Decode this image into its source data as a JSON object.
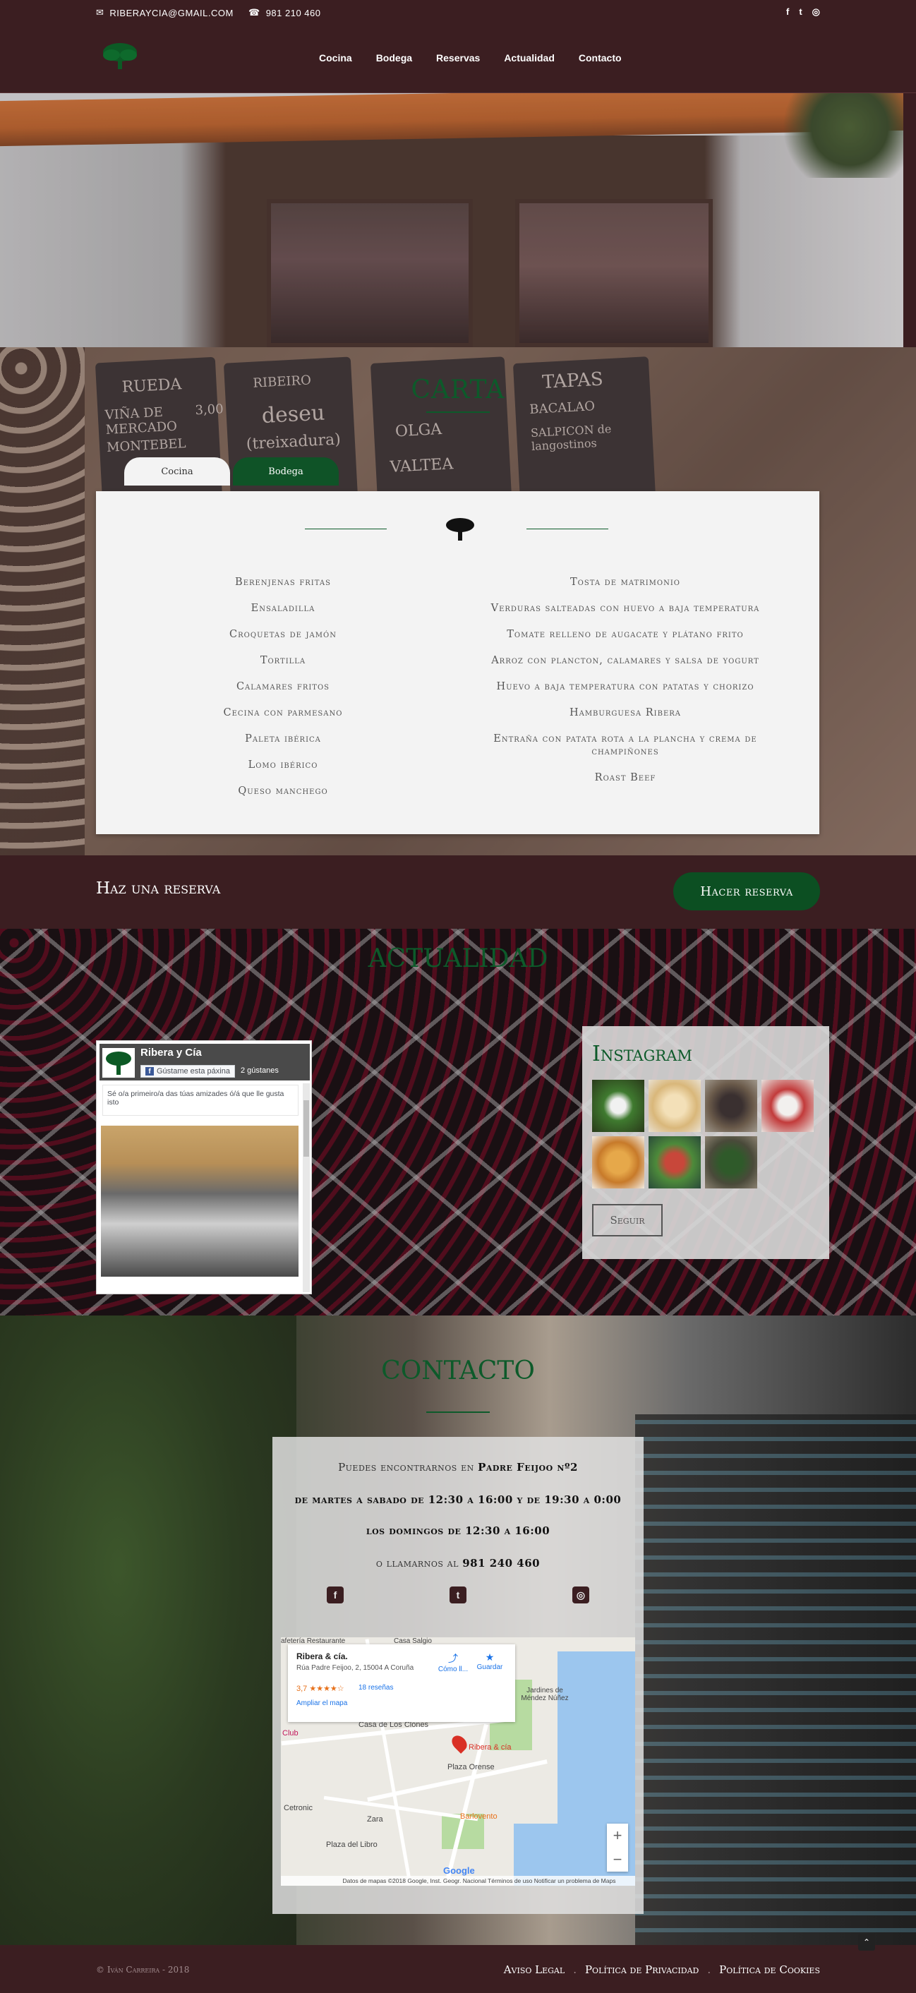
{
  "topbar": {
    "email": "RIBERAYCIA@GMAIL.COM",
    "phone": "981 210 460",
    "social": [
      "f",
      "t",
      "ig"
    ]
  },
  "nav": {
    "items": [
      "Cocina",
      "Bodega",
      "Reservas",
      "Actualidad",
      "Contacto"
    ]
  },
  "carta": {
    "title": "CARTA",
    "tabs": {
      "active": "Cocina",
      "inactive": "Bodega"
    },
    "left_dishes": [
      "Berenjenas fritas",
      "Ensaladilla",
      "Croquetas de jamón",
      "Tortilla",
      "Calamares fritos",
      "Cecina con parmesano",
      "Paleta ibérica",
      "Lomo ibérico",
      "Queso manchego"
    ],
    "right_dishes": [
      "Tosta de matrimonio",
      "Verduras salteadas con huevo a baja temperatura",
      "Tomate relleno de augacate y plátano frito",
      "Arroz con plancton, calamares y salsa de yogurt",
      "Huevo a baja temperatura con patatas y chorizo",
      "Hamburguesa Ribera",
      "Entraña con patata rota a la plancha y crema de champiñones",
      "Roast Beef"
    ],
    "board": [
      "RUEDA",
      "VIÑA DE MERCADO",
      "3,00",
      "MONTEBEL",
      "RIBEIRO",
      "deseu",
      "(treixadura)",
      "OLGA",
      "VALTEA",
      "TAPAS",
      "BACALAO",
      "SALPICON de langostinos"
    ]
  },
  "reserva": {
    "text": "Haz una reserva",
    "button": "Hacer reserva"
  },
  "social": {
    "title": "ACTUALIDAD",
    "facebook": {
      "page_name": "Ribera y Cía",
      "like_label": "Gústame esta páxina",
      "like_count": "2 gústanes",
      "message": "Sé o/a primeiro/a das túas amizades ó/á que lle gusta isto"
    },
    "instagram": {
      "title": "Instagram",
      "follow": "Seguir"
    }
  },
  "contacto": {
    "title": "CONTACTO",
    "find_us": "Puedes encontrarnos en",
    "address": "Padre Feijoo nº2",
    "hours_week": "de martes a sabado de 12:30 a 16:00 y de 19:30 a 0:00",
    "hours_sunday": "los domingos de 12:30 a 16:00",
    "call_us": "o llamarnos al",
    "phone": "981 240 460",
    "map": {
      "place_name": "Ribera & cía.",
      "place_address": "Rúa Padre Feijoo, 2, 15004 A Coruña",
      "rating": "3,7 ★★★★☆",
      "reviews": "18 reseñas",
      "enlarge": "Ampliar el mapa",
      "directions": "Cómo ll...",
      "save": "Guardar",
      "labels": [
        "Casa de Los Clones",
        "Plaza Orense",
        "Ribera & cía",
        "Barlovento",
        "Plaza del Libro",
        "Zara",
        "Cetronic",
        "Club",
        "Jardines de Méndez Núñez",
        "afetería Restaurante",
        "Casa Salgio"
      ],
      "footer": "Datos de mapas ©2018 Google, Inst. Geogr. Nacional   Términos de uso   Notificar un problema de Maps",
      "google": "Google"
    }
  },
  "footer": {
    "copyright": "© Iván Carreira - 2018",
    "links": [
      "Aviso Legal",
      "Política de Privacidad",
      "Política de Cookies"
    ]
  },
  "colors": {
    "burgundy": "#3b1e21",
    "green": "#0d5a2a",
    "button_green": "#0c4f22"
  }
}
